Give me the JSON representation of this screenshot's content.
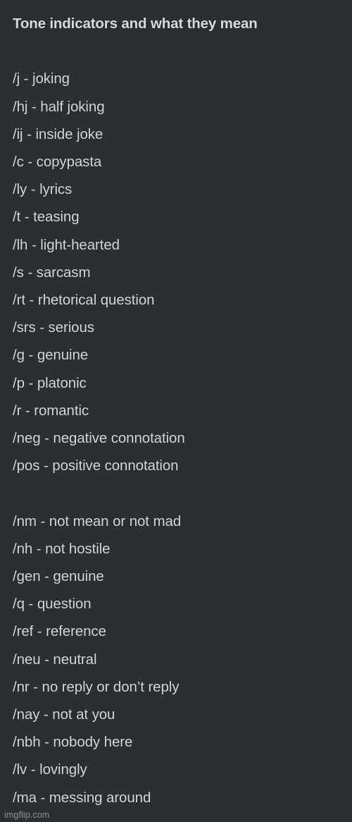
{
  "meme": {
    "title": "Tone indicators and what they mean",
    "background_color": "#2b2e32",
    "text_color": "#d5d8da",
    "watermark": "imgflip.com",
    "separator": " - ",
    "groups": [
      {
        "group_name": "primary-tone-indicators",
        "items": [
          {
            "code": "/j",
            "sep": " - ",
            "meaning": "joking",
            "line": "/j - joking"
          },
          {
            "code": "/hj",
            "sep": " - ",
            "meaning": "half joking",
            "line": "/hj - half joking"
          },
          {
            "code": "/ij",
            "sep": " - ",
            "meaning": "inside joke",
            "line": "/ij - inside joke"
          },
          {
            "code": "/c",
            "sep": " - ",
            "meaning": "copypasta",
            "line": "/c - copypasta"
          },
          {
            "code": "/ly",
            "sep": " - ",
            "meaning": "lyrics",
            "line": "/ly - lyrics"
          },
          {
            "code": "/t",
            "sep": " - ",
            "meaning": "teasing",
            "line": "/t - teasing"
          },
          {
            "code": "/lh",
            "sep": " - ",
            "meaning": "light-hearted",
            "line": "/lh - light-hearted"
          },
          {
            "code": "/s",
            "sep": " - ",
            "meaning": "sarcasm",
            "line": "/s - sarcasm"
          },
          {
            "code": "/rt",
            "sep": " - ",
            "meaning": "rhetorical question",
            "line": "/rt - rhetorical question"
          },
          {
            "code": "/srs",
            "sep": " - ",
            "meaning": "serious",
            "line": "/srs - serious"
          },
          {
            "code": "/g",
            "sep": " - ",
            "meaning": "genuine",
            "line": "/g - genuine"
          },
          {
            "code": "/p",
            "sep": " - ",
            "meaning": "platonic",
            "line": "/p - platonic"
          },
          {
            "code": "/r",
            "sep": " - ",
            "meaning": "romantic",
            "line": "/r - romantic"
          },
          {
            "code": "/neg",
            "sep": " - ",
            "meaning": "negative connotation",
            "line": "/neg - negative connotation"
          },
          {
            "code": "/pos",
            "sep": " - ",
            "meaning": "positive connotation",
            "line": "/pos - positive connotation"
          }
        ]
      },
      {
        "group_name": "secondary-tone-indicators",
        "items": [
          {
            "code": "/nm",
            "sep": " - ",
            "meaning": "not mean or not mad",
            "line": "/nm - not mean or not mad"
          },
          {
            "code": "/nh",
            "sep": " - ",
            "meaning": "not hostile",
            "line": "/nh - not hostile"
          },
          {
            "code": "/gen",
            "sep": " - ",
            "meaning": "genuine",
            "line": "/gen - genuine"
          },
          {
            "code": "/q",
            "sep": " - ",
            "meaning": "question",
            "line": "/q - question"
          },
          {
            "code": "/ref",
            "sep": " - ",
            "meaning": "reference",
            "line": "/ref - reference"
          },
          {
            "code": "/neu",
            "sep": " - ",
            "meaning": "neutral",
            "line": "/neu - neutral"
          },
          {
            "code": "/nr",
            "sep": " - ",
            "meaning": "no reply or don’t reply",
            "line": "/nr - no reply or don’t reply"
          },
          {
            "code": "/nay",
            "sep": " - ",
            "meaning": "not at you",
            "line": "/nay - not at you"
          },
          {
            "code": "/nbh",
            "sep": " - ",
            "meaning": "nobody here",
            "line": "/nbh - nobody here"
          },
          {
            "code": "/lv",
            "sep": " - ",
            "meaning": "lovingly",
            "line": "/lv - lovingly"
          },
          {
            "code": "/ma",
            "sep": " - ",
            "meaning": "messing around",
            "line": "/ma - messing around"
          }
        ]
      }
    ]
  }
}
